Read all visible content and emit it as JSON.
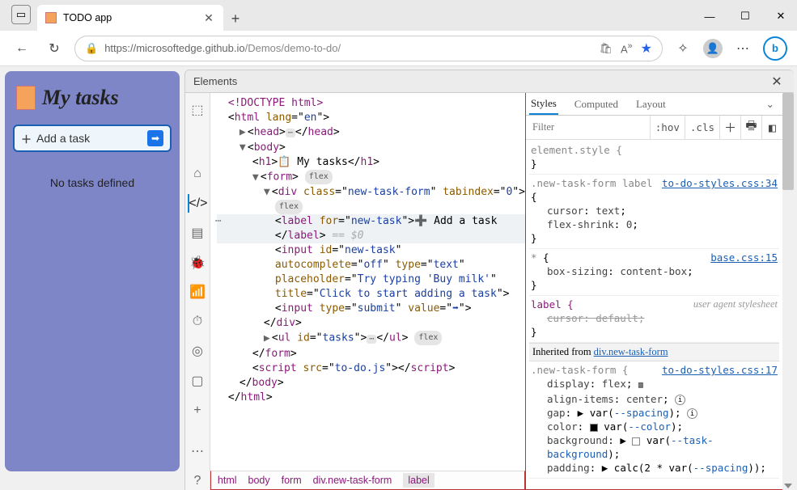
{
  "window": {
    "tab_title": "TODO app"
  },
  "toolbar": {
    "url_host": "https://microsoftedge.github.io",
    "url_path": "/Demos/demo-to-do/"
  },
  "app": {
    "title": "My tasks",
    "add_label": "Add a task",
    "empty": "No tasks defined"
  },
  "devtools": {
    "panel_title": "Elements",
    "styles_tabs": {
      "styles": "Styles",
      "computed": "Computed",
      "layout": "Layout"
    },
    "filter_ph": "Filter",
    "hov": ":hov",
    "cls": ".cls",
    "breadcrumb": [
      "html",
      "body",
      "form",
      "div.new-task-form",
      "label"
    ],
    "dom": {
      "doctype": "<!DOCTYPE html>",
      "html_open": "html",
      "lang": "en",
      "head": "head",
      "body": "body",
      "h1_text": " My tasks",
      "form": "form",
      "div_class": "new-task-form",
      "tabindex": "0",
      "label_for": "new-task",
      "label_text": " Add a task",
      "eq0": " == $0",
      "input_id": "new-task",
      "autocomplete": "off",
      "input_type": "text",
      "placeholder": "Try typing 'Buy milk'",
      "title_attr": "Click to start adding a task",
      "submit_val": "➡",
      "ul_id": "tasks",
      "script_src": "to-do.js"
    },
    "rules": {
      "element_style": "element.style {",
      "r1_sel": ".new-task-form label",
      "r1_link": "to-do-styles.css:34",
      "r1_p1": "cursor",
      "r1_v1": "text",
      "r1_p2": "flex-shrink",
      "r1_v2": "0",
      "r2_sel": "*",
      "r2_link": "base.css:15",
      "r2_p1": "box-sizing",
      "r2_v1": "content-box",
      "r3_sel": "label {",
      "r3_ua": "user agent stylesheet",
      "r3_p1": "cursor: default;",
      "inh_label": "Inherited from ",
      "inh_link": "div.new-task-form",
      "r4_sel": ".new-task-form {",
      "r4_link": "to-do-styles.css:17",
      "r4_p1": "display",
      "r4_v1": "flex",
      "r4_p2": "align-items",
      "r4_v2": "center",
      "r4_p3": "gap",
      "r4_v3": "var",
      "r4_v3a": "--spacing",
      "r4_p4": "color",
      "r4_v4": "var",
      "r4_v4a": "--color",
      "r4_p5": "background",
      "r4_v5": "var",
      "r4_v5a": "--task-background",
      "r4_p6": "padding",
      "r4_v6": "calc(2 * var",
      "r4_v6a": "--spacing"
    }
  }
}
